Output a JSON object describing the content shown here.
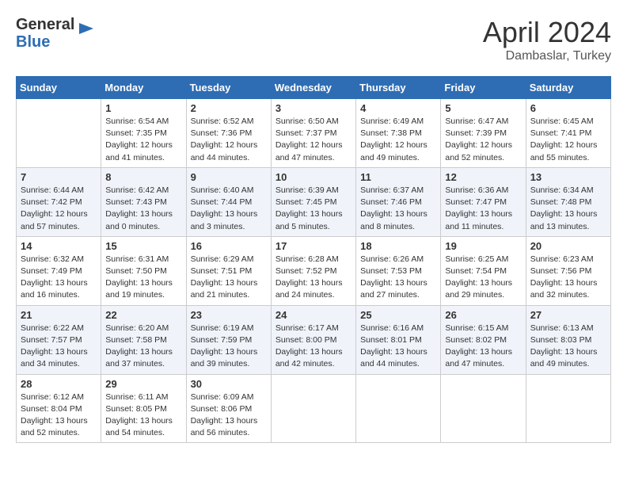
{
  "header": {
    "logo_line1": "General",
    "logo_line2": "Blue",
    "month_year": "April 2024",
    "location": "Dambaslar, Turkey"
  },
  "days_of_week": [
    "Sunday",
    "Monday",
    "Tuesday",
    "Wednesday",
    "Thursday",
    "Friday",
    "Saturday"
  ],
  "weeks": [
    [
      {
        "day": "",
        "sunrise": "",
        "sunset": "",
        "daylight": ""
      },
      {
        "day": "1",
        "sunrise": "Sunrise: 6:54 AM",
        "sunset": "Sunset: 7:35 PM",
        "daylight": "Daylight: 12 hours and 41 minutes."
      },
      {
        "day": "2",
        "sunrise": "Sunrise: 6:52 AM",
        "sunset": "Sunset: 7:36 PM",
        "daylight": "Daylight: 12 hours and 44 minutes."
      },
      {
        "day": "3",
        "sunrise": "Sunrise: 6:50 AM",
        "sunset": "Sunset: 7:37 PM",
        "daylight": "Daylight: 12 hours and 47 minutes."
      },
      {
        "day": "4",
        "sunrise": "Sunrise: 6:49 AM",
        "sunset": "Sunset: 7:38 PM",
        "daylight": "Daylight: 12 hours and 49 minutes."
      },
      {
        "day": "5",
        "sunrise": "Sunrise: 6:47 AM",
        "sunset": "Sunset: 7:39 PM",
        "daylight": "Daylight: 12 hours and 52 minutes."
      },
      {
        "day": "6",
        "sunrise": "Sunrise: 6:45 AM",
        "sunset": "Sunset: 7:41 PM",
        "daylight": "Daylight: 12 hours and 55 minutes."
      }
    ],
    [
      {
        "day": "7",
        "sunrise": "Sunrise: 6:44 AM",
        "sunset": "Sunset: 7:42 PM",
        "daylight": "Daylight: 12 hours and 57 minutes."
      },
      {
        "day": "8",
        "sunrise": "Sunrise: 6:42 AM",
        "sunset": "Sunset: 7:43 PM",
        "daylight": "Daylight: 13 hours and 0 minutes."
      },
      {
        "day": "9",
        "sunrise": "Sunrise: 6:40 AM",
        "sunset": "Sunset: 7:44 PM",
        "daylight": "Daylight: 13 hours and 3 minutes."
      },
      {
        "day": "10",
        "sunrise": "Sunrise: 6:39 AM",
        "sunset": "Sunset: 7:45 PM",
        "daylight": "Daylight: 13 hours and 5 minutes."
      },
      {
        "day": "11",
        "sunrise": "Sunrise: 6:37 AM",
        "sunset": "Sunset: 7:46 PM",
        "daylight": "Daylight: 13 hours and 8 minutes."
      },
      {
        "day": "12",
        "sunrise": "Sunrise: 6:36 AM",
        "sunset": "Sunset: 7:47 PM",
        "daylight": "Daylight: 13 hours and 11 minutes."
      },
      {
        "day": "13",
        "sunrise": "Sunrise: 6:34 AM",
        "sunset": "Sunset: 7:48 PM",
        "daylight": "Daylight: 13 hours and 13 minutes."
      }
    ],
    [
      {
        "day": "14",
        "sunrise": "Sunrise: 6:32 AM",
        "sunset": "Sunset: 7:49 PM",
        "daylight": "Daylight: 13 hours and 16 minutes."
      },
      {
        "day": "15",
        "sunrise": "Sunrise: 6:31 AM",
        "sunset": "Sunset: 7:50 PM",
        "daylight": "Daylight: 13 hours and 19 minutes."
      },
      {
        "day": "16",
        "sunrise": "Sunrise: 6:29 AM",
        "sunset": "Sunset: 7:51 PM",
        "daylight": "Daylight: 13 hours and 21 minutes."
      },
      {
        "day": "17",
        "sunrise": "Sunrise: 6:28 AM",
        "sunset": "Sunset: 7:52 PM",
        "daylight": "Daylight: 13 hours and 24 minutes."
      },
      {
        "day": "18",
        "sunrise": "Sunrise: 6:26 AM",
        "sunset": "Sunset: 7:53 PM",
        "daylight": "Daylight: 13 hours and 27 minutes."
      },
      {
        "day": "19",
        "sunrise": "Sunrise: 6:25 AM",
        "sunset": "Sunset: 7:54 PM",
        "daylight": "Daylight: 13 hours and 29 minutes."
      },
      {
        "day": "20",
        "sunrise": "Sunrise: 6:23 AM",
        "sunset": "Sunset: 7:56 PM",
        "daylight": "Daylight: 13 hours and 32 minutes."
      }
    ],
    [
      {
        "day": "21",
        "sunrise": "Sunrise: 6:22 AM",
        "sunset": "Sunset: 7:57 PM",
        "daylight": "Daylight: 13 hours and 34 minutes."
      },
      {
        "day": "22",
        "sunrise": "Sunrise: 6:20 AM",
        "sunset": "Sunset: 7:58 PM",
        "daylight": "Daylight: 13 hours and 37 minutes."
      },
      {
        "day": "23",
        "sunrise": "Sunrise: 6:19 AM",
        "sunset": "Sunset: 7:59 PM",
        "daylight": "Daylight: 13 hours and 39 minutes."
      },
      {
        "day": "24",
        "sunrise": "Sunrise: 6:17 AM",
        "sunset": "Sunset: 8:00 PM",
        "daylight": "Daylight: 13 hours and 42 minutes."
      },
      {
        "day": "25",
        "sunrise": "Sunrise: 6:16 AM",
        "sunset": "Sunset: 8:01 PM",
        "daylight": "Daylight: 13 hours and 44 minutes."
      },
      {
        "day": "26",
        "sunrise": "Sunrise: 6:15 AM",
        "sunset": "Sunset: 8:02 PM",
        "daylight": "Daylight: 13 hours and 47 minutes."
      },
      {
        "day": "27",
        "sunrise": "Sunrise: 6:13 AM",
        "sunset": "Sunset: 8:03 PM",
        "daylight": "Daylight: 13 hours and 49 minutes."
      }
    ],
    [
      {
        "day": "28",
        "sunrise": "Sunrise: 6:12 AM",
        "sunset": "Sunset: 8:04 PM",
        "daylight": "Daylight: 13 hours and 52 minutes."
      },
      {
        "day": "29",
        "sunrise": "Sunrise: 6:11 AM",
        "sunset": "Sunset: 8:05 PM",
        "daylight": "Daylight: 13 hours and 54 minutes."
      },
      {
        "day": "30",
        "sunrise": "Sunrise: 6:09 AM",
        "sunset": "Sunset: 8:06 PM",
        "daylight": "Daylight: 13 hours and 56 minutes."
      },
      {
        "day": "",
        "sunrise": "",
        "sunset": "",
        "daylight": ""
      },
      {
        "day": "",
        "sunrise": "",
        "sunset": "",
        "daylight": ""
      },
      {
        "day": "",
        "sunrise": "",
        "sunset": "",
        "daylight": ""
      },
      {
        "day": "",
        "sunrise": "",
        "sunset": "",
        "daylight": ""
      }
    ]
  ]
}
